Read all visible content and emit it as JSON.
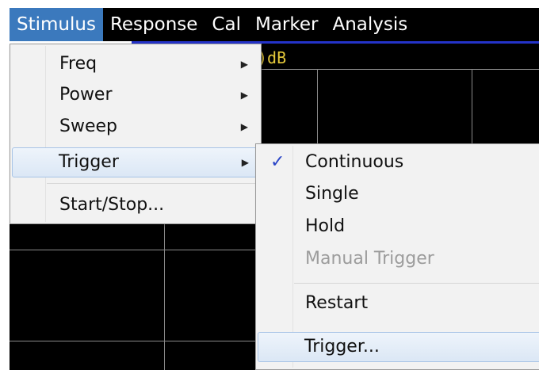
{
  "menubar": {
    "items": [
      "Stimulus",
      "Response",
      "Cal",
      "Marker",
      "Analysis"
    ]
  },
  "display": {
    "readout": ")dB"
  },
  "stimulus_menu": {
    "items": [
      {
        "label": "Freq",
        "submenu": true
      },
      {
        "label": "Power",
        "submenu": true
      },
      {
        "label": "Sweep",
        "submenu": true
      },
      {
        "label": "Trigger",
        "submenu": true,
        "highlighted": true
      },
      {
        "label": "Start/Stop...",
        "submenu": false
      }
    ]
  },
  "trigger_menu": {
    "items": [
      {
        "label": "Continuous",
        "checked": true
      },
      {
        "label": "Single"
      },
      {
        "label": "Hold"
      },
      {
        "label": "Manual Trigger",
        "disabled": true
      },
      {
        "label": "Restart"
      },
      {
        "label": "Trigger...",
        "highlighted": true
      }
    ]
  },
  "colors": {
    "menubar_bg": "#000000",
    "menubar_active": "#3b79bd",
    "checkmark": "#2a45c7",
    "trace_label": "#e5c93a"
  }
}
